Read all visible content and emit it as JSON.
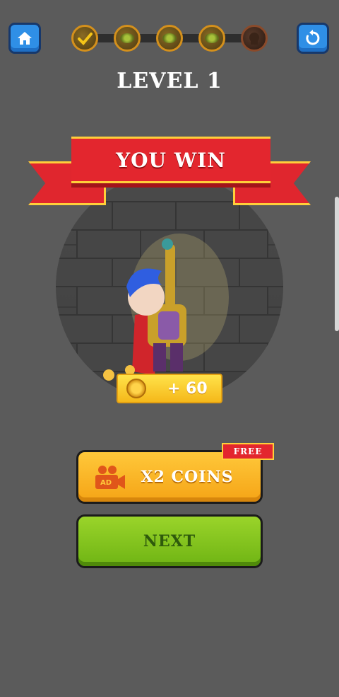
{
  "header": {
    "home_icon": "home-icon",
    "restart_icon": "restart-icon",
    "level_title": "LEVEL 1"
  },
  "progress": {
    "levels": [
      {
        "state": "completed",
        "icon": "checkmark-icon"
      },
      {
        "state": "upcoming",
        "icon": "treasure-icon"
      },
      {
        "state": "upcoming",
        "icon": "treasure-icon"
      },
      {
        "state": "upcoming",
        "icon": "treasure-icon"
      },
      {
        "state": "boss",
        "icon": "boss-icon"
      }
    ]
  },
  "banner": {
    "text": "YOU WIN",
    "color": "#e3262e",
    "trim": "#ffcf3a"
  },
  "reward": {
    "icon": "coin-icon",
    "text": "+ 60"
  },
  "actions": {
    "double_coins": {
      "badge": "FREE",
      "ad_label": "AD",
      "label": "X2 COINS",
      "color": "#f5a416"
    },
    "next": {
      "label": "NEXT",
      "color": "#7fc21e"
    }
  }
}
